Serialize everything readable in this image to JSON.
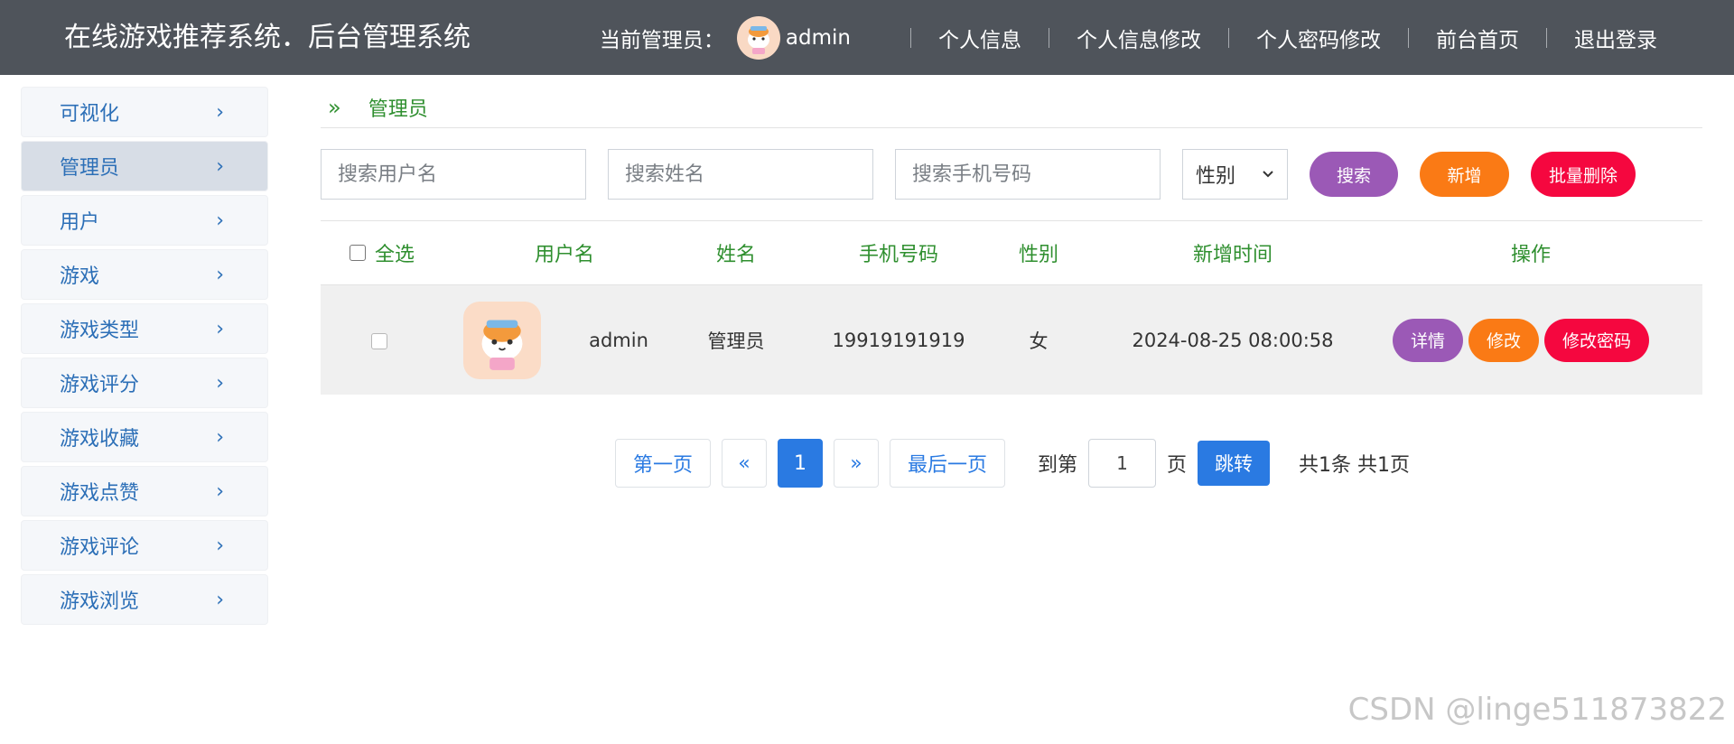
{
  "header": {
    "title": "在线游戏推荐系统．后台管理系统",
    "current_admin_label": "当前管理员：",
    "username": "admin",
    "links": [
      "个人信息",
      "个人信息修改",
      "个人密码修改",
      "前台首页",
      "退出登录"
    ]
  },
  "sidebar": {
    "items": [
      {
        "label": "可视化"
      },
      {
        "label": "管理员"
      },
      {
        "label": "用户"
      },
      {
        "label": "游戏"
      },
      {
        "label": "游戏类型"
      },
      {
        "label": "游戏评分"
      },
      {
        "label": "游戏收藏"
      },
      {
        "label": "游戏点赞"
      },
      {
        "label": "游戏评论"
      },
      {
        "label": "游戏浏览"
      }
    ],
    "active_index": 1,
    "chevron": "›"
  },
  "breadcrumb": {
    "arrow": "»",
    "label": "管理员"
  },
  "search": {
    "username_placeholder": "搜索用户名",
    "name_placeholder": "搜索姓名",
    "phone_placeholder": "搜索手机号码",
    "gender_select": "性别",
    "search_label": "搜索",
    "add_label": "新增",
    "batch_delete_label": "批量删除"
  },
  "table": {
    "select_all": "全选",
    "columns": [
      "用户名",
      "姓名",
      "手机号码",
      "性别",
      "新增时间",
      "操作"
    ],
    "rows": [
      {
        "username": "admin",
        "name": "管理员",
        "phone": "19919191919",
        "gender": "女",
        "created": "2024-08-25 08:00:58",
        "actions": [
          "详情",
          "修改",
          "修改密码"
        ]
      }
    ]
  },
  "pagination": {
    "first": "第一页",
    "prev": "«",
    "current": "1",
    "next": "»",
    "last": "最后一页",
    "goto_prefix": "到第",
    "goto_value": "1",
    "goto_suffix": "页",
    "jump": "跳转",
    "total": "共1条 共1页"
  },
  "watermark": "CSDN @linge511873822",
  "colors": {
    "topbar": "#4f545b",
    "accent_green": "#2f8f2f",
    "link_blue": "#2c6fb7",
    "purple": "#9b59b6",
    "orange": "#fa7a15",
    "red": "#f5073f",
    "primary": "#2a7ae2"
  }
}
